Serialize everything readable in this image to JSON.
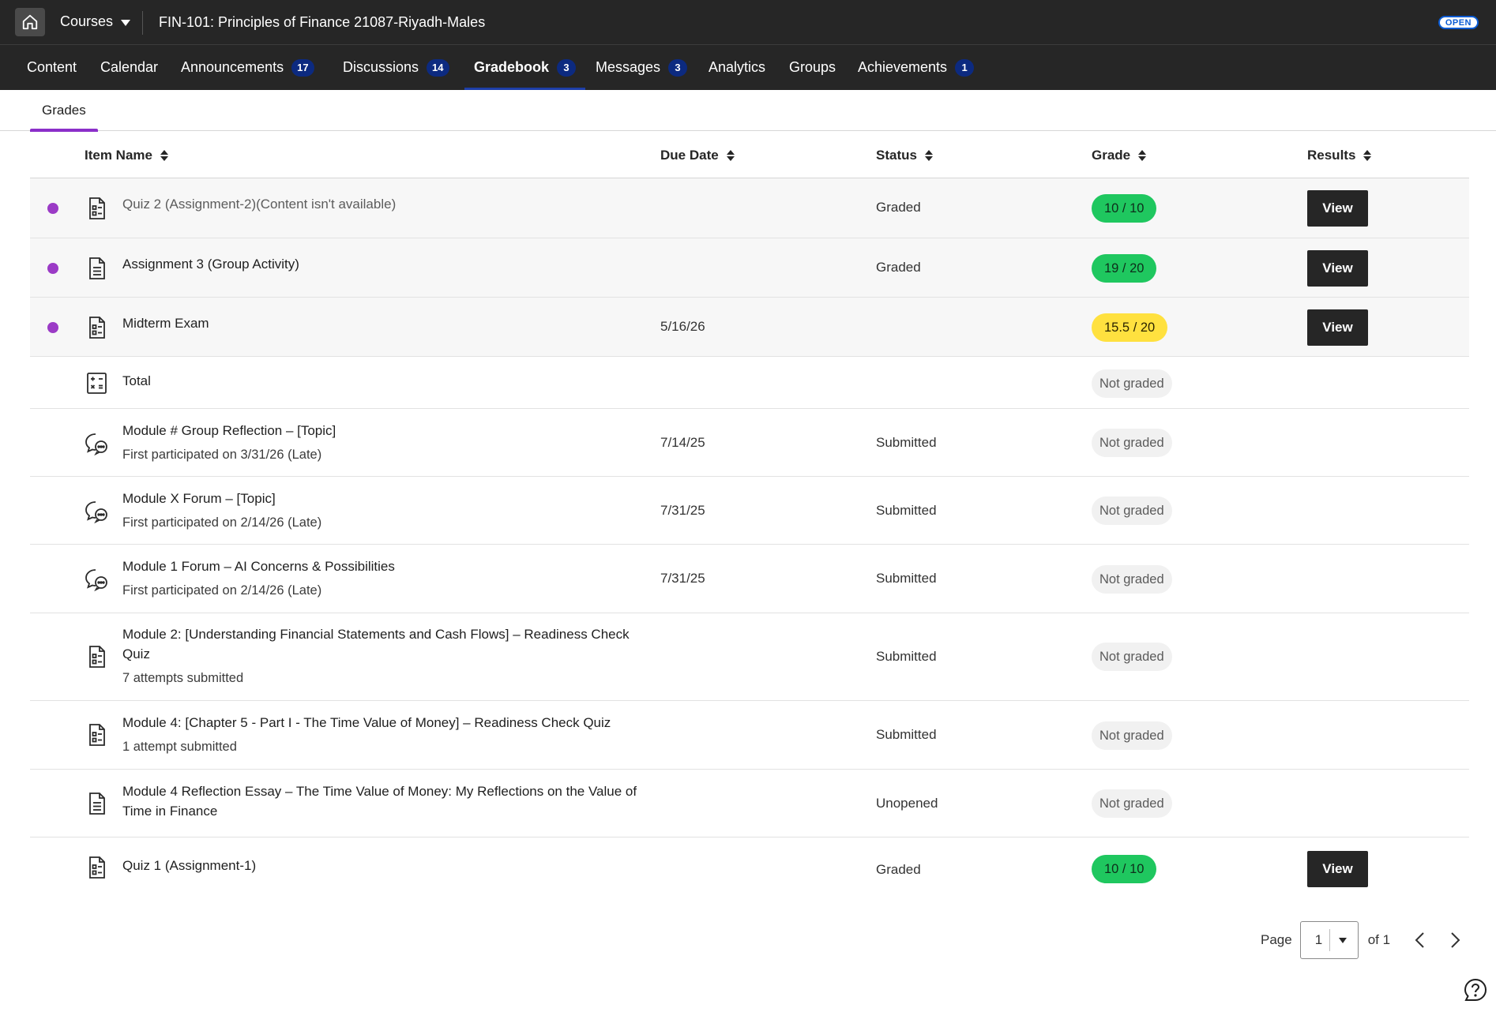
{
  "topbar": {
    "courses_label": "Courses",
    "course_title": "FIN-101: Principles of Finance 21087-Riyadh-Males",
    "open_badge": "OPEN"
  },
  "nav": [
    {
      "label": "Content",
      "badge": ""
    },
    {
      "label": "Calendar",
      "badge": ""
    },
    {
      "label": "Announcements",
      "badge": "17"
    },
    {
      "label": "Discussions",
      "badge": "14"
    },
    {
      "label": "Gradebook",
      "badge": "3",
      "active": true
    },
    {
      "label": "Messages",
      "badge": "3"
    },
    {
      "label": "Analytics",
      "badge": ""
    },
    {
      "label": "Groups",
      "badge": ""
    },
    {
      "label": "Achievements",
      "badge": "1"
    }
  ],
  "subtabs": {
    "grades": "Grades"
  },
  "table": {
    "headers": {
      "item_name": "Item Name",
      "due_date": "Due Date",
      "status": "Status",
      "grade": "Grade",
      "results": "Results"
    },
    "rows": [
      {
        "icon": "assessment-icon",
        "name": "Quiz 2 (Assignment-2)(Content isn't available)",
        "sub": "",
        "due": "",
        "status": "Graded",
        "grade": "10 / 10",
        "grade_style": "green",
        "view": "View",
        "new": true
      },
      {
        "icon": "document-icon",
        "name": "Assignment 3 (Group Activity)",
        "sub": "",
        "due": "",
        "status": "Graded",
        "grade": "19 / 20",
        "grade_style": "green",
        "view": "View",
        "new": true
      },
      {
        "icon": "assessment-icon",
        "name": "Midterm Exam",
        "sub": "",
        "due": "5/16/26",
        "status": "",
        "grade": "15.5 / 20",
        "grade_style": "yellow",
        "view": "View",
        "new": true
      },
      {
        "icon": "calculation-icon",
        "name": "Total",
        "sub": "",
        "due": "",
        "status": "",
        "grade": "Not graded",
        "grade_style": "grey",
        "view": "",
        "new": false
      },
      {
        "icon": "discussion-icon",
        "name": "Module # Group Reflection – [Topic]",
        "sub": "First participated on 3/31/26 (Late)",
        "due": "7/14/25",
        "status": "Submitted",
        "grade": "Not graded",
        "grade_style": "grey",
        "view": "",
        "new": false
      },
      {
        "icon": "discussion-icon",
        "name": "Module X Forum – [Topic]",
        "sub": "First participated on 2/14/26 (Late)",
        "due": "7/31/25",
        "status": "Submitted",
        "grade": "Not graded",
        "grade_style": "grey",
        "view": "",
        "new": false
      },
      {
        "icon": "discussion-icon",
        "name": "Module 1 Forum – AI Concerns & Possibilities",
        "sub": "First participated on 2/14/26 (Late)",
        "due": "7/31/25",
        "status": "Submitted",
        "grade": "Not graded",
        "grade_style": "grey",
        "view": "",
        "new": false
      },
      {
        "icon": "assessment-icon",
        "name": "Module 2: [Understanding Financial Statements and Cash Flows] – Readiness Check Quiz",
        "sub": "7 attempts submitted",
        "due": "",
        "status": "Submitted",
        "grade": "Not graded",
        "grade_style": "grey",
        "view": "",
        "new": false
      },
      {
        "icon": "assessment-icon",
        "name": "Module 4: [Chapter 5 - Part I - The Time Value of Money] – Readiness Check Quiz",
        "sub": "1 attempt submitted",
        "due": "",
        "status": "Submitted",
        "grade": "Not graded",
        "grade_style": "grey",
        "view": "",
        "new": false
      },
      {
        "icon": "document-icon",
        "name": "Module 4 Reflection Essay – The Time Value of Money: My Reflections on the Value of Time in Finance",
        "sub": "",
        "due": "",
        "status": "Unopened",
        "grade": "Not graded",
        "grade_style": "grey",
        "view": "",
        "new": false
      },
      {
        "icon": "assessment-icon",
        "name": "Quiz 1 (Assignment-1)",
        "sub": "",
        "due": "",
        "status": "Graded",
        "grade": "10 / 10",
        "grade_style": "green",
        "view": "View",
        "new": false
      }
    ]
  },
  "pagination": {
    "page_label": "Page",
    "current": "1",
    "of_label": "of 1"
  },
  "colors": {
    "accent_purple": "#8b2fc9",
    "grade_green": "#1fc75f",
    "grade_yellow": "#ffe13f",
    "nav_bg": "#262626",
    "badge_navy": "#0c2a80"
  }
}
